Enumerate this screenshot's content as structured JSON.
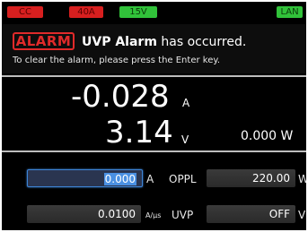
{
  "status_bar": {
    "mode": "CC",
    "current_range": "40A",
    "voltage_range": "15V",
    "lan": "LAN"
  },
  "alarm": {
    "tag": "ALARM",
    "title_bold": "UVP Alarm",
    "title_rest": " has occurred.",
    "hint": "To clear the alarm, please press the Enter key."
  },
  "measurement": {
    "current_value": "-0.028",
    "current_unit": "A",
    "voltage_value": "3.14",
    "voltage_unit": "V",
    "power": "0.000 W"
  },
  "settings": {
    "current_setpoint": "0.000",
    "current_unit": "A",
    "slew_rate": "0.0100",
    "slew_unit": "A/µs",
    "oppl_label": "OPPL",
    "oppl_value": "220.00",
    "oppl_unit": "W",
    "uvp_label": "UVP",
    "uvp_value": "OFF",
    "uvp_unit": "V"
  },
  "colors": {
    "badge_red": "#d71f1f",
    "badge_green": "#31c23a",
    "alarm_red": "#e02a2a",
    "highlight_blue": "#4a90e2"
  }
}
